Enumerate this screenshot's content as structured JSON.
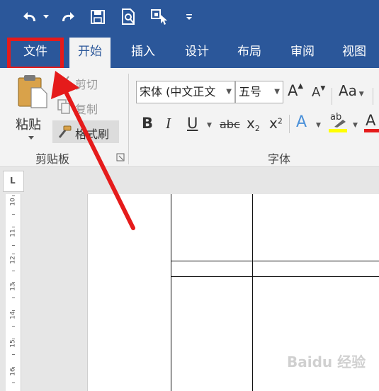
{
  "quick_access": {
    "undo_icon": "undo-icon",
    "redo_icon": "redo-icon",
    "save_icon": "save-icon",
    "print_preview_icon": "print-preview-icon",
    "touch_mode_icon": "touch-mode-icon",
    "customize_icon": "customize-dropdown-icon"
  },
  "tabs": [
    {
      "label": "文件"
    },
    {
      "label": "开始"
    },
    {
      "label": "插入"
    },
    {
      "label": "设计"
    },
    {
      "label": "布局"
    },
    {
      "label": "审阅"
    },
    {
      "label": "视图"
    }
  ],
  "ribbon": {
    "clipboard": {
      "paste_label": "粘贴",
      "cut_label": "剪切",
      "copy_label": "复制",
      "format_painter_label": "格式刷",
      "group_label": "剪贴板"
    },
    "font": {
      "font_name": "宋体 (中文正文",
      "font_size": "五号",
      "grow_label": "A",
      "shrink_label": "A",
      "case_label": "Aa",
      "bold": "B",
      "italic": "I",
      "underline": "U",
      "strike": "abc",
      "subscript": "x",
      "sub_mark": "2",
      "superscript": "x",
      "sup_mark": "2",
      "text_effect": "A",
      "highlight": "ab",
      "font_color": "A",
      "group_label": "字体"
    }
  },
  "ruler": {
    "corner": "L",
    "numbers": [
      "10",
      "11",
      "12",
      "13",
      "14",
      "15",
      "16"
    ]
  },
  "watermark": "Baidu 经验",
  "colors": {
    "title_bar": "#2b579a",
    "highlight_box": "#e51b1b",
    "arrow": "#e51b1b",
    "highlight_yellow": "#ffff00",
    "font_color_red": "#e51b1b"
  }
}
